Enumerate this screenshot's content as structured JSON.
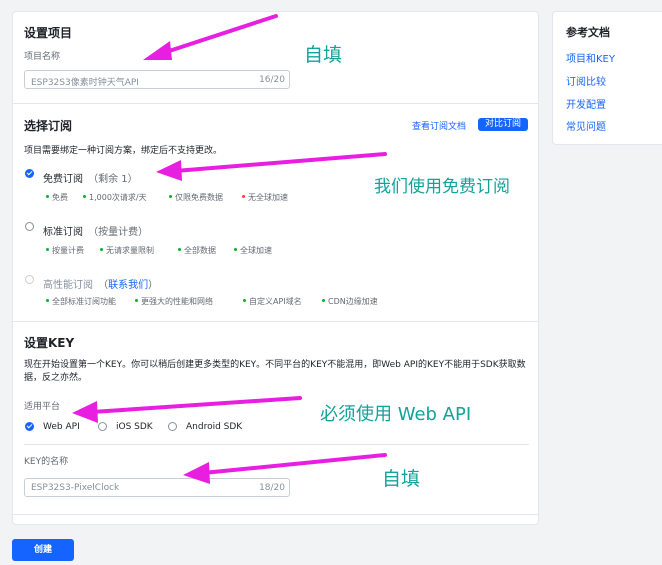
{
  "project": {
    "section_title": "设置项目",
    "name_label": "项目名称",
    "name_value": "ESP32S3像素时钟天气API",
    "name_count": "16/20"
  },
  "subscription": {
    "section_title": "选择订阅",
    "view_docs_link": "查看订阅文档",
    "compare_button": "对比订阅",
    "description": "项目需要绑定一种订阅方案，绑定后不支持更改。",
    "plans": [
      {
        "name": "免费订阅",
        "sub": "（剩余 1）",
        "selected": true,
        "features": [
          "免费",
          "1,000次请求/天",
          "仅限免费数据",
          "无全球加速"
        ],
        "feature_colors": [
          "#00b42a",
          "#00b42a",
          "#00b42a",
          "#f53f3f"
        ]
      },
      {
        "name": "标准订阅",
        "sub": "（按量计费）",
        "selected": false,
        "features": [
          "按量计费",
          "无请求量限制",
          "全部数据",
          "全球加速"
        ],
        "feature_colors": [
          "#00b42a",
          "#00b42a",
          "#00b42a",
          "#00b42a"
        ]
      },
      {
        "name": "高性能订阅",
        "sub_prefix": "（",
        "sub_link": "联系我们",
        "sub_suffix": "）",
        "selected": false,
        "disabled": true,
        "features": [
          "全部标准订阅功能",
          "更强大的性能和网络",
          "自定义API域名",
          "CDN边缘加速"
        ],
        "feature_colors": [
          "#00b42a",
          "#00b42a",
          "#00b42a",
          "#00b42a"
        ]
      }
    ]
  },
  "key": {
    "section_title": "设置KEY",
    "description": "现在开始设置第一个KEY。你可以稍后创建更多类型的KEY。不同平台的KEY不能混用，即Web API的KEY不能用于SDK获取数据，反之亦然。",
    "platform_label": "适用平台",
    "platforms": [
      {
        "label": "Web API",
        "selected": true
      },
      {
        "label": "iOS SDK",
        "selected": false
      },
      {
        "label": "Android SDK",
        "selected": false
      }
    ],
    "key_name_label": "KEY的名称",
    "key_name_value": "ESP32S3-PixelClock",
    "key_name_count": "18/20"
  },
  "create_button": "创建",
  "sidebar": {
    "title": "参考文档",
    "links": [
      "项目和KEY",
      "订阅比较",
      "开发配置",
      "常见问题"
    ]
  },
  "annotations": {
    "fill_in_1": "自填",
    "use_free": "我们使用免费订阅",
    "must_web_api": "必须使用 Web API",
    "fill_in_2": "自填"
  },
  "colors": {
    "accent": "#1664ff",
    "annotation_text": "#12a39a",
    "arrow": "#e81ee0",
    "feature_ok": "#00b42a",
    "feature_no": "#f53f3f"
  }
}
